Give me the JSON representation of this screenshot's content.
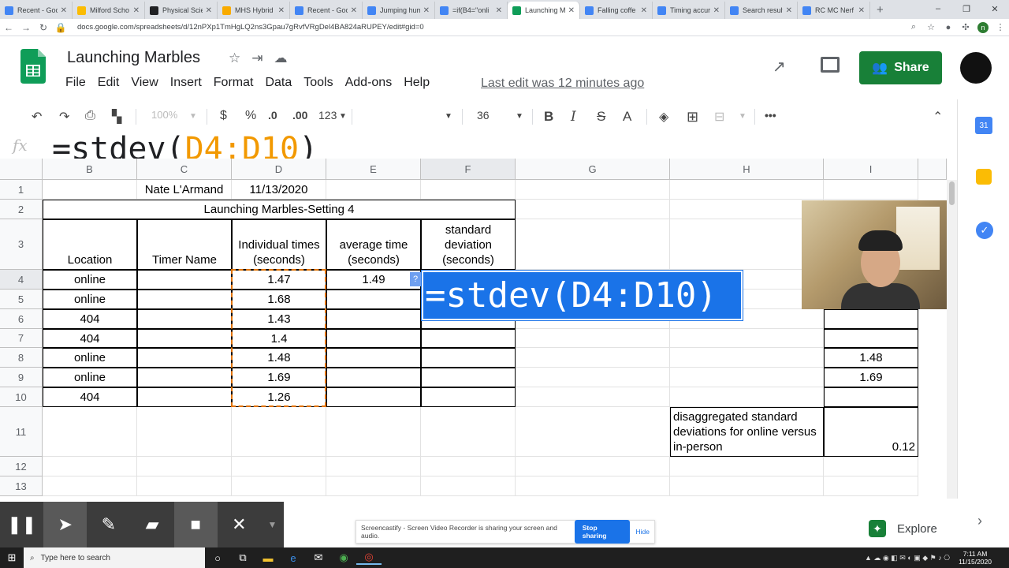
{
  "browser": {
    "tabs": [
      {
        "label": "Recent - Goo",
        "color": "#4285f4"
      },
      {
        "label": "Milford Scho",
        "color": "#fbbc04"
      },
      {
        "label": "Physical Scie",
        "color": "#202124"
      },
      {
        "label": "MHS Hybrid",
        "color": "#f9ab00"
      },
      {
        "label": "Recent - Goo",
        "color": "#4285f4"
      },
      {
        "label": "Jumping hum",
        "color": "#4285f4"
      },
      {
        "label": "=if(B4=\"onli",
        "color": "#4285f4"
      },
      {
        "label": "Launching M",
        "color": "#0f9d58",
        "active": true
      },
      {
        "label": "Falling coffe",
        "color": "#4285f4"
      },
      {
        "label": "Timing accur",
        "color": "#4285f4"
      },
      {
        "label": "Search result",
        "color": "#4285f4"
      },
      {
        "label": "RC MC Nerf",
        "color": "#4285f4"
      }
    ],
    "url": "docs.google.com/spreadsheets/d/12nPXp1TmHgLQ2ns3Gpau7gRvfVRgDel4BA824aRUPEY/edit#gid=0",
    "profile_initial": "n"
  },
  "sheets": {
    "title": "Launching Marbles",
    "menu": [
      "File",
      "Edit",
      "View",
      "Insert",
      "Format",
      "Data",
      "Tools",
      "Add-ons",
      "Help"
    ],
    "last_edit": "Last edit was 12 minutes ago",
    "share_label": "Share"
  },
  "toolbar": {
    "zoom": "100%",
    "currency": "$",
    "percent": "%",
    "decrease_decimal": ".0",
    "increase_decimal": ".00",
    "more_formats": "123",
    "font_size": "36",
    "bold": "B",
    "italic": "I",
    "strike": "S",
    "text_color": "A",
    "more": "•••"
  },
  "formula_bar": {
    "fx": "fx",
    "prefix": "=stdev(",
    "ref": "D4:D10",
    "suffix": ")"
  },
  "grid": {
    "columns": [
      "B",
      "C",
      "D",
      "E",
      "F",
      "G",
      "H",
      "I"
    ],
    "rows": [
      "1",
      "2",
      "3",
      "4",
      "5",
      "6",
      "7",
      "8",
      "9",
      "10",
      "11",
      "12",
      "13"
    ],
    "cells": {
      "C1": "Nate L'Armand",
      "D1": "11/13/2020",
      "B2": "Launching Marbles-Setting 4",
      "B3": "Location",
      "C3": "Timer Name",
      "D3": "Individual times (seconds)",
      "E3": "average time (seconds)",
      "F3": "standard deviation (seconds)",
      "B4": "online",
      "D4": "1.47",
      "E4": "1.49",
      "B5": "online",
      "D5": "1.68",
      "B6": "404",
      "D6": "1.43",
      "B7": "404",
      "D7": "1.4",
      "B8": "online",
      "D8": "1.48",
      "I8": "1.48",
      "B9": "online",
      "D9": "1.69",
      "I9": "1.69",
      "B10": "404",
      "D10": "1.26",
      "H11": "disaggregated standard deviations for online versus in-person",
      "I11": "0.12"
    },
    "popup_formula": "=stdev(D4:D10)",
    "help_mark": "?"
  },
  "screencastify": {
    "notice": "Screencastify - Screen Video Recorder is sharing your screen and audio.",
    "stop_label": "Stop sharing",
    "hide_label": "Hide"
  },
  "explore_label": "Explore",
  "taskbar": {
    "search_placeholder": "Type here to search",
    "time": "7:11 AM",
    "date": "11/15/2020"
  }
}
